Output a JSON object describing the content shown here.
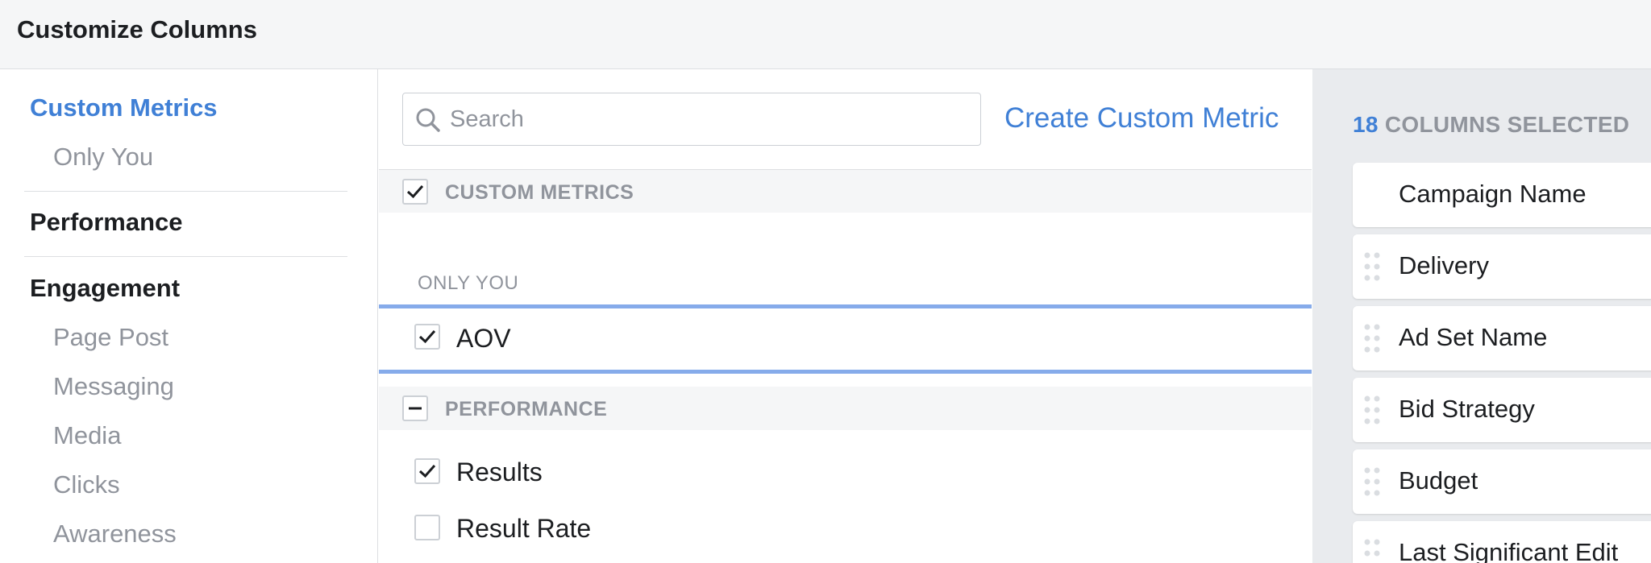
{
  "window": {
    "title": "Customize Columns"
  },
  "sidebar": {
    "items": [
      {
        "label": "Custom Metrics",
        "kind": "active"
      },
      {
        "label": "Only You",
        "kind": "sub"
      },
      {
        "label": "Performance",
        "kind": "bold"
      },
      {
        "label": "Engagement",
        "kind": "bold"
      },
      {
        "label": "Page Post",
        "kind": "sub"
      },
      {
        "label": "Messaging",
        "kind": "sub"
      },
      {
        "label": "Media",
        "kind": "sub"
      },
      {
        "label": "Clicks",
        "kind": "sub"
      },
      {
        "label": "Awareness",
        "kind": "sub"
      }
    ]
  },
  "search": {
    "placeholder": "Search",
    "value": ""
  },
  "create_link": "Create Custom Metric",
  "sections": {
    "custom_metrics": {
      "label": "CUSTOM METRICS",
      "state": "checked"
    },
    "only_you": {
      "label": "ONLY YOU"
    },
    "aov": {
      "label": "AOV",
      "checked": true
    },
    "performance": {
      "label": "PERFORMANCE",
      "state": "indeterminate"
    },
    "results": {
      "label": "Results",
      "checked": true
    },
    "result_rate": {
      "label": "Result Rate",
      "checked": false
    }
  },
  "selected": {
    "count": "18",
    "suffix": "COLUMNS SELECTED",
    "columns": [
      {
        "name": "Campaign Name",
        "draggable": false
      },
      {
        "name": "Delivery",
        "draggable": true
      },
      {
        "name": "Ad Set Name",
        "draggable": true
      },
      {
        "name": "Bid Strategy",
        "draggable": true
      },
      {
        "name": "Budget",
        "draggable": true
      },
      {
        "name": "Last Significant Edit",
        "draggable": true
      }
    ]
  },
  "colors": {
    "accent": "#4080d6",
    "muted": "#90949c",
    "highlight": "#86abea"
  }
}
